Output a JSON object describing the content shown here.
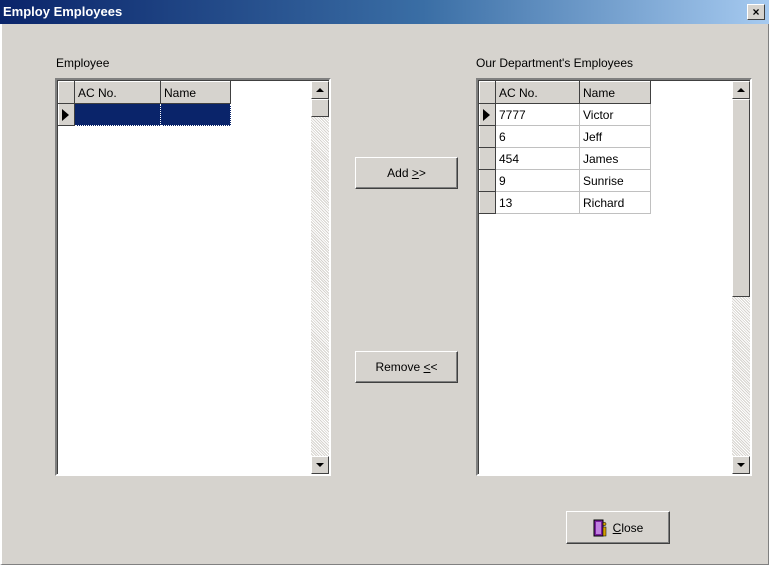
{
  "window": {
    "title": "Employ Employees",
    "close_glyph": "×"
  },
  "left": {
    "label": "Employee",
    "columns": [
      "AC No.",
      "Name"
    ],
    "rows": []
  },
  "right": {
    "label": "Our Department's Employees",
    "columns": [
      "AC No.",
      "Name"
    ],
    "rows": [
      {
        "ac": "7777",
        "name": "Victor"
      },
      {
        "ac": "6",
        "name": "Jeff"
      },
      {
        "ac": "454",
        "name": "James"
      },
      {
        "ac": "9",
        "name": "Sunrise"
      },
      {
        "ac": "13",
        "name": "Richard"
      }
    ]
  },
  "buttons": {
    "add_prefix": "Add ",
    "add_accel": ">",
    "add_suffix": ">",
    "remove_prefix": "Remove ",
    "remove_accel": "<",
    "remove_suffix": "<",
    "close_accel": "C",
    "close_suffix": "lose",
    "close_icon": "door-exit-icon"
  },
  "colors": {
    "title_start": "#0a246a",
    "title_end": "#a6caf0",
    "selection": "#0a246a",
    "face": "#d6d3ce"
  }
}
